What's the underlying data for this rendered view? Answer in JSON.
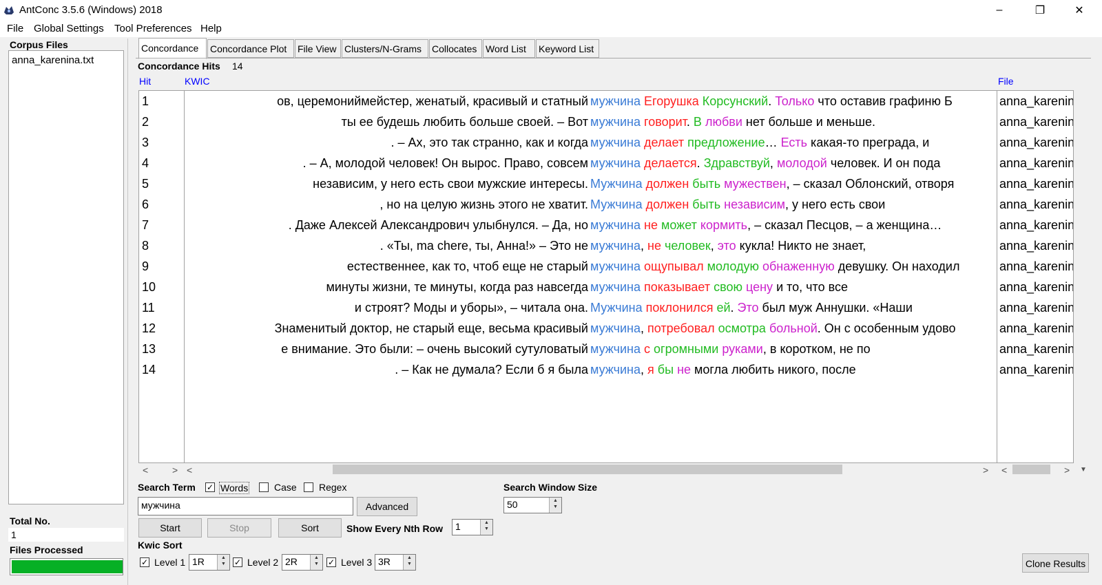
{
  "window": {
    "title": "AntConc 3.5.6 (Windows) 2018",
    "minimize": "–",
    "maximize": "❐",
    "close": "✕"
  },
  "menu": [
    "File",
    "Global Settings",
    "Tool Preferences",
    "Help"
  ],
  "left": {
    "corpus_files_label": "Corpus Files",
    "files": [
      "anna_karenina.txt"
    ],
    "total_no_label": "Total No.",
    "total_no_value": "1",
    "files_processed_label": "Files Processed",
    "progress_fraction": 1.0,
    "progress_color": "#06b025"
  },
  "tabs": [
    "Concordance",
    "Concordance Plot",
    "File View",
    "Clusters/N-Grams",
    "Collocates",
    "Word List",
    "Keyword List"
  ],
  "active_tab": "Concordance",
  "hits": {
    "label": "Concordance Hits",
    "count": "14"
  },
  "columns": {
    "hit": "Hit",
    "kwic": "KWIC",
    "file": "File"
  },
  "rows": [
    {
      "hit": "1",
      "left": "ов, церемониймейстер, женатый, красивый и статный",
      "right": [
        [
          "мужчина",
          "b"
        ],
        [
          " ",
          ""
        ],
        [
          "Егорушка",
          "r"
        ],
        [
          " ",
          ""
        ],
        [
          "Корсунский",
          "g"
        ],
        [
          ". ",
          ""
        ],
        [
          "Только",
          "m"
        ],
        [
          " что оставив графиню Б",
          ""
        ]
      ],
      "file": "anna_karenina.txt"
    },
    {
      "hit": "2",
      "left": "ты ее будешь любить больше своей.  – Вот",
      "right": [
        [
          "мужчина",
          "b"
        ],
        [
          " ",
          ""
        ],
        [
          "говорит",
          "r"
        ],
        [
          ". ",
          ""
        ],
        [
          "В",
          "g"
        ],
        [
          " ",
          ""
        ],
        [
          "любви",
          "m"
        ],
        [
          " нет больше и меньше.",
          ""
        ]
      ],
      "file": "anna_karenina.txt"
    },
    {
      "hit": "3",
      "left": ".  – Ах, это так странно, как и когда",
      "right": [
        [
          "мужчина",
          "b"
        ],
        [
          " ",
          ""
        ],
        [
          "делает",
          "r"
        ],
        [
          " ",
          ""
        ],
        [
          "предложение",
          "g"
        ],
        [
          "… ",
          ""
        ],
        [
          "Есть",
          "m"
        ],
        [
          " какая-то преграда, и",
          ""
        ]
      ],
      "file": "anna_karenina.txt"
    },
    {
      "hit": "4",
      "left": ".  – А, молодой человек! Он вырос. Право, совсем",
      "right": [
        [
          "мужчина",
          "b"
        ],
        [
          " ",
          ""
        ],
        [
          "делается",
          "r"
        ],
        [
          ". ",
          ""
        ],
        [
          "Здравствуй",
          "g"
        ],
        [
          ", ",
          ""
        ],
        [
          "молодой",
          "m"
        ],
        [
          " человек.  И он пода",
          ""
        ]
      ],
      "file": "anna_karenina.txt"
    },
    {
      "hit": "5",
      "left": "независим, у него есть свои мужские интересы.",
      "right": [
        [
          "Мужчина",
          "b"
        ],
        [
          " ",
          ""
        ],
        [
          "должен",
          "r"
        ],
        [
          " ",
          ""
        ],
        [
          "быть",
          "g"
        ],
        [
          " ",
          ""
        ],
        [
          "мужествен",
          "m"
        ],
        [
          ", – сказал Облонский, отворя",
          ""
        ]
      ],
      "file": "anna_karenina.txt"
    },
    {
      "hit": "6",
      "left": ", но на целую жизнь этого не хватит.",
      "right": [
        [
          "Мужчина",
          "b"
        ],
        [
          " ",
          ""
        ],
        [
          "должен",
          "r"
        ],
        [
          " ",
          ""
        ],
        [
          "быть",
          "g"
        ],
        [
          " ",
          ""
        ],
        [
          "независим",
          "m"
        ],
        [
          ", у него есть свои",
          ""
        ]
      ],
      "file": "anna_karenina.txt"
    },
    {
      "hit": "7",
      "left": ". Даже Алексей Александрович улыбнулся.  – Да, но",
      "right": [
        [
          "мужчина",
          "b"
        ],
        [
          " ",
          ""
        ],
        [
          "не",
          "r"
        ],
        [
          " ",
          ""
        ],
        [
          "может",
          "g"
        ],
        [
          " ",
          ""
        ],
        [
          "кормить",
          "m"
        ],
        [
          ", – сказал Песцов, – а женщина…",
          ""
        ]
      ],
      "file": "anna_karenina.txt"
    },
    {
      "hit": "8",
      "left": ". «Ты, ma chere, ты, Анна!»  – Это не",
      "right": [
        [
          "мужчина",
          "b"
        ],
        [
          ", ",
          ""
        ],
        [
          "не",
          "r"
        ],
        [
          " ",
          ""
        ],
        [
          "человек",
          "g"
        ],
        [
          ", ",
          ""
        ],
        [
          "это",
          "m"
        ],
        [
          " кукла! Никто не знает,",
          ""
        ]
      ],
      "file": "anna_karenina.txt"
    },
    {
      "hit": "9",
      "left": "естественнее, как то, чтоб еще не старый",
      "right": [
        [
          "мужчина",
          "b"
        ],
        [
          " ",
          ""
        ],
        [
          "ощупывал",
          "r"
        ],
        [
          " ",
          ""
        ],
        [
          "молодую",
          "g"
        ],
        [
          " ",
          ""
        ],
        [
          "обнаженную",
          "m"
        ],
        [
          " девушку. Он находил",
          ""
        ]
      ],
      "file": "anna_karenina.txt"
    },
    {
      "hit": "10",
      "left": "минуты жизни, те минуты, когда раз навсегда",
      "right": [
        [
          "мужчина",
          "b"
        ],
        [
          " ",
          ""
        ],
        [
          "показывает",
          "r"
        ],
        [
          " ",
          ""
        ],
        [
          "свою",
          "g"
        ],
        [
          " ",
          ""
        ],
        [
          "цену",
          "m"
        ],
        [
          " и то, что все",
          ""
        ]
      ],
      "file": "anna_karenina.txt"
    },
    {
      "hit": "11",
      "left": "и строят? Моды и уборы», – читала она.",
      "right": [
        [
          "Мужчина",
          "b"
        ],
        [
          " ",
          ""
        ],
        [
          "поклонился",
          "r"
        ],
        [
          " ",
          ""
        ],
        [
          "ей",
          "g"
        ],
        [
          ". ",
          ""
        ],
        [
          "Это",
          "m"
        ],
        [
          " был муж Аннушки. «Наши",
          ""
        ]
      ],
      "file": "anna_karenina.txt"
    },
    {
      "hit": "12",
      "left": "Знаменитый доктор, не старый еще, весьма красивый",
      "right": [
        [
          "мужчина",
          "b"
        ],
        [
          ", ",
          ""
        ],
        [
          "потребовал",
          "r"
        ],
        [
          " ",
          ""
        ],
        [
          "осмотра",
          "g"
        ],
        [
          " ",
          ""
        ],
        [
          "больной",
          "m"
        ],
        [
          ". Он с особенным удово",
          ""
        ]
      ],
      "file": "anna_karenina.txt"
    },
    {
      "hit": "13",
      "left": "е внимание. Это были: – очень высокий сутуловатый",
      "right": [
        [
          "мужчина",
          "b"
        ],
        [
          " ",
          ""
        ],
        [
          "с",
          "r"
        ],
        [
          " ",
          ""
        ],
        [
          "огромными",
          "g"
        ],
        [
          " ",
          ""
        ],
        [
          "руками",
          "m"
        ],
        [
          ", в коротком, не по",
          ""
        ]
      ],
      "file": "anna_karenina.txt"
    },
    {
      "hit": "14",
      "left": ".  – Как не думала? Если б я была",
      "right": [
        [
          "мужчина",
          "b"
        ],
        [
          ", ",
          ""
        ],
        [
          "я",
          "r"
        ],
        [
          " ",
          ""
        ],
        [
          "бы",
          "g"
        ],
        [
          " ",
          ""
        ],
        [
          "не",
          "m"
        ],
        [
          " могла любить никого, после",
          ""
        ]
      ],
      "file": "anna_karenina.txt"
    }
  ],
  "colors": {
    "b": "#3a7bd5",
    "r": "#ff2020",
    "g": "#22bb22",
    "m": "#cc22cc",
    "header": "#0000ff"
  },
  "search": {
    "term_label": "Search Term",
    "words_label": "Words",
    "words_checked": true,
    "case_label": "Case",
    "case_checked": false,
    "regex_label": "Regex",
    "regex_checked": false,
    "term_value": "мужчина",
    "advanced_label": "Advanced",
    "window_size_label": "Search Window Size",
    "window_size_value": "50"
  },
  "actions": {
    "start": "Start",
    "stop": "Stop",
    "sort": "Sort",
    "nth_row_label": "Show Every Nth Row",
    "nth_row_value": "1",
    "clone": "Clone Results"
  },
  "kwic_sort": {
    "label": "Kwic Sort",
    "levels": [
      {
        "label": "Level 1",
        "value": "1R",
        "checked": true
      },
      {
        "label": "Level 2",
        "value": "2R",
        "checked": true
      },
      {
        "label": "Level 3",
        "value": "3R",
        "checked": true
      }
    ]
  }
}
